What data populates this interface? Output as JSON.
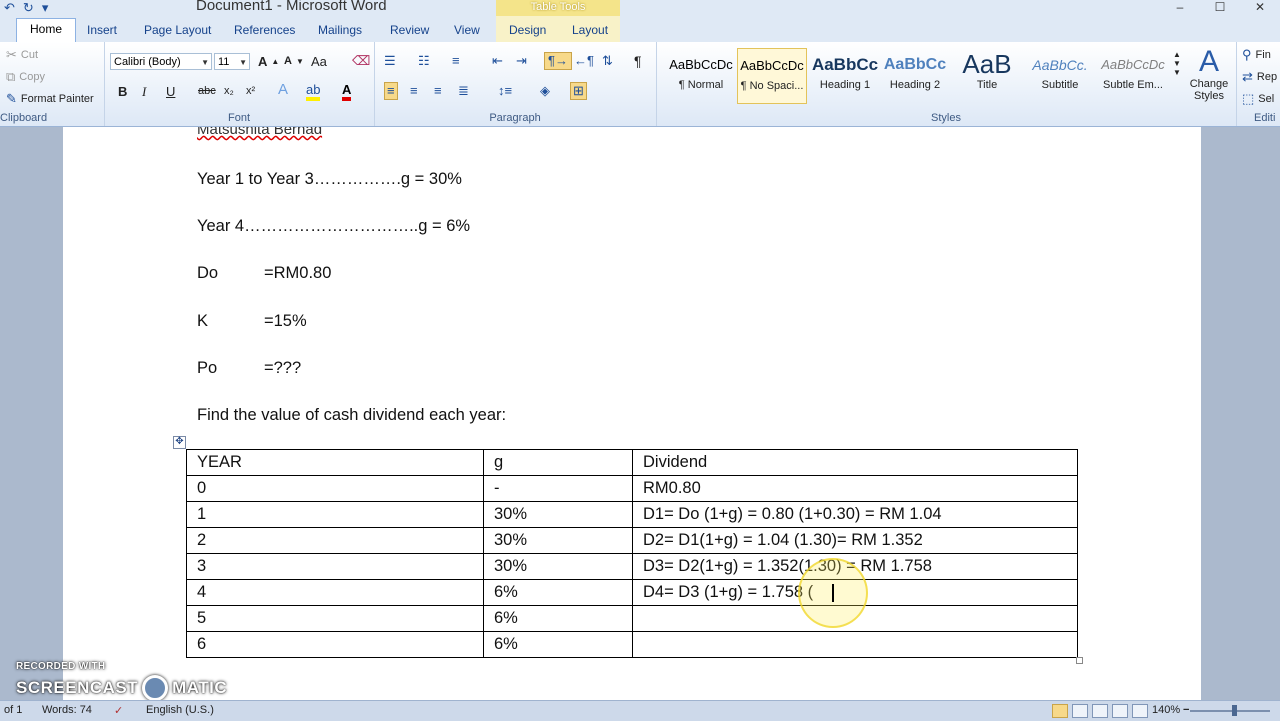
{
  "window": {
    "title": "Document1  -  Microsoft Word",
    "context_group": "Table Tools",
    "controls": [
      "–",
      "☐",
      "✕"
    ]
  },
  "tabs": [
    {
      "label": "Home",
      "active": true
    },
    {
      "label": "Insert"
    },
    {
      "label": "Page Layout"
    },
    {
      "label": "References"
    },
    {
      "label": "Mailings"
    },
    {
      "label": "Review"
    },
    {
      "label": "View"
    },
    {
      "label": "Design"
    },
    {
      "label": "Layout"
    }
  ],
  "ribbon": {
    "clipboard": {
      "cut": "Cut",
      "copy": "Copy",
      "format_painter": "Format Painter",
      "label": "Clipboard"
    },
    "font": {
      "family": "Calibri (Body)",
      "size": "11",
      "label": "Font",
      "grow": "A",
      "shrink": "A",
      "change_case": "Aa",
      "bold": "B",
      "italic": "I",
      "underline": "U",
      "strike": "abc",
      "subscript": "x₂",
      "superscript": "x²"
    },
    "paragraph": {
      "label": "Paragraph",
      "pilcrow": "¶"
    },
    "styles": {
      "label": "Styles",
      "items": [
        {
          "sample": "AaBbCcDc",
          "name": "¶ Normal"
        },
        {
          "sample": "AaBbCcDc",
          "name": "¶ No Spaci..."
        },
        {
          "sample": "AaBbCc",
          "name": "Heading 1"
        },
        {
          "sample": "AaBbCc",
          "name": "Heading 2"
        },
        {
          "sample": "AaB",
          "name": "Title"
        },
        {
          "sample": "AaBbCc.",
          "name": "Subtitle"
        },
        {
          "sample": "AaBbCcDc",
          "name": "Subtle Em..."
        }
      ],
      "change_styles": "Change Styles"
    },
    "editing": {
      "find": "Fin",
      "replace": "Rep",
      "select": "Sel",
      "label": "Editi"
    }
  },
  "document": {
    "partial_line": "Matsushita Berhad",
    "lines": [
      {
        "text": "Year 1 to Year 3…………….g = 30%"
      },
      {
        "text": "Year 4…………………………..g = 6%"
      },
      {
        "label": "Do",
        "value": "=RM0.80"
      },
      {
        "label": "K",
        "value": "=15%"
      },
      {
        "label": "Po",
        "value": "=???"
      },
      {
        "text": "Find the value of cash dividend each year:"
      }
    ],
    "table": {
      "headers": [
        "YEAR",
        "g",
        "Dividend"
      ],
      "rows": [
        [
          "0",
          "-",
          "RM0.80"
        ],
        [
          "1",
          "30%",
          "D1= Do (1+g) = 0.80 (1+0.30) = RM 1.04"
        ],
        [
          "2",
          "30%",
          "D2= D1(1+g) = 1.04 (1.30)= RM 1.352"
        ],
        [
          "3",
          "30%",
          "D3= D2(1+g) = 1.352(1.30)  = RM 1.758"
        ],
        [
          "4",
          "6%",
          "D4= D3 (1+g) = 1.758 ("
        ],
        [
          "5",
          "6%",
          ""
        ],
        [
          "6",
          "6%",
          ""
        ]
      ]
    }
  },
  "watermark": {
    "line1": "RECORDED WITH",
    "line2a": "SCREENCAST",
    "line2b": "MATIC"
  },
  "status": {
    "page": "of 1",
    "words": "Words: 74",
    "language": "English (U.S.)",
    "zoom": "140%",
    "zoom_level": 140
  }
}
